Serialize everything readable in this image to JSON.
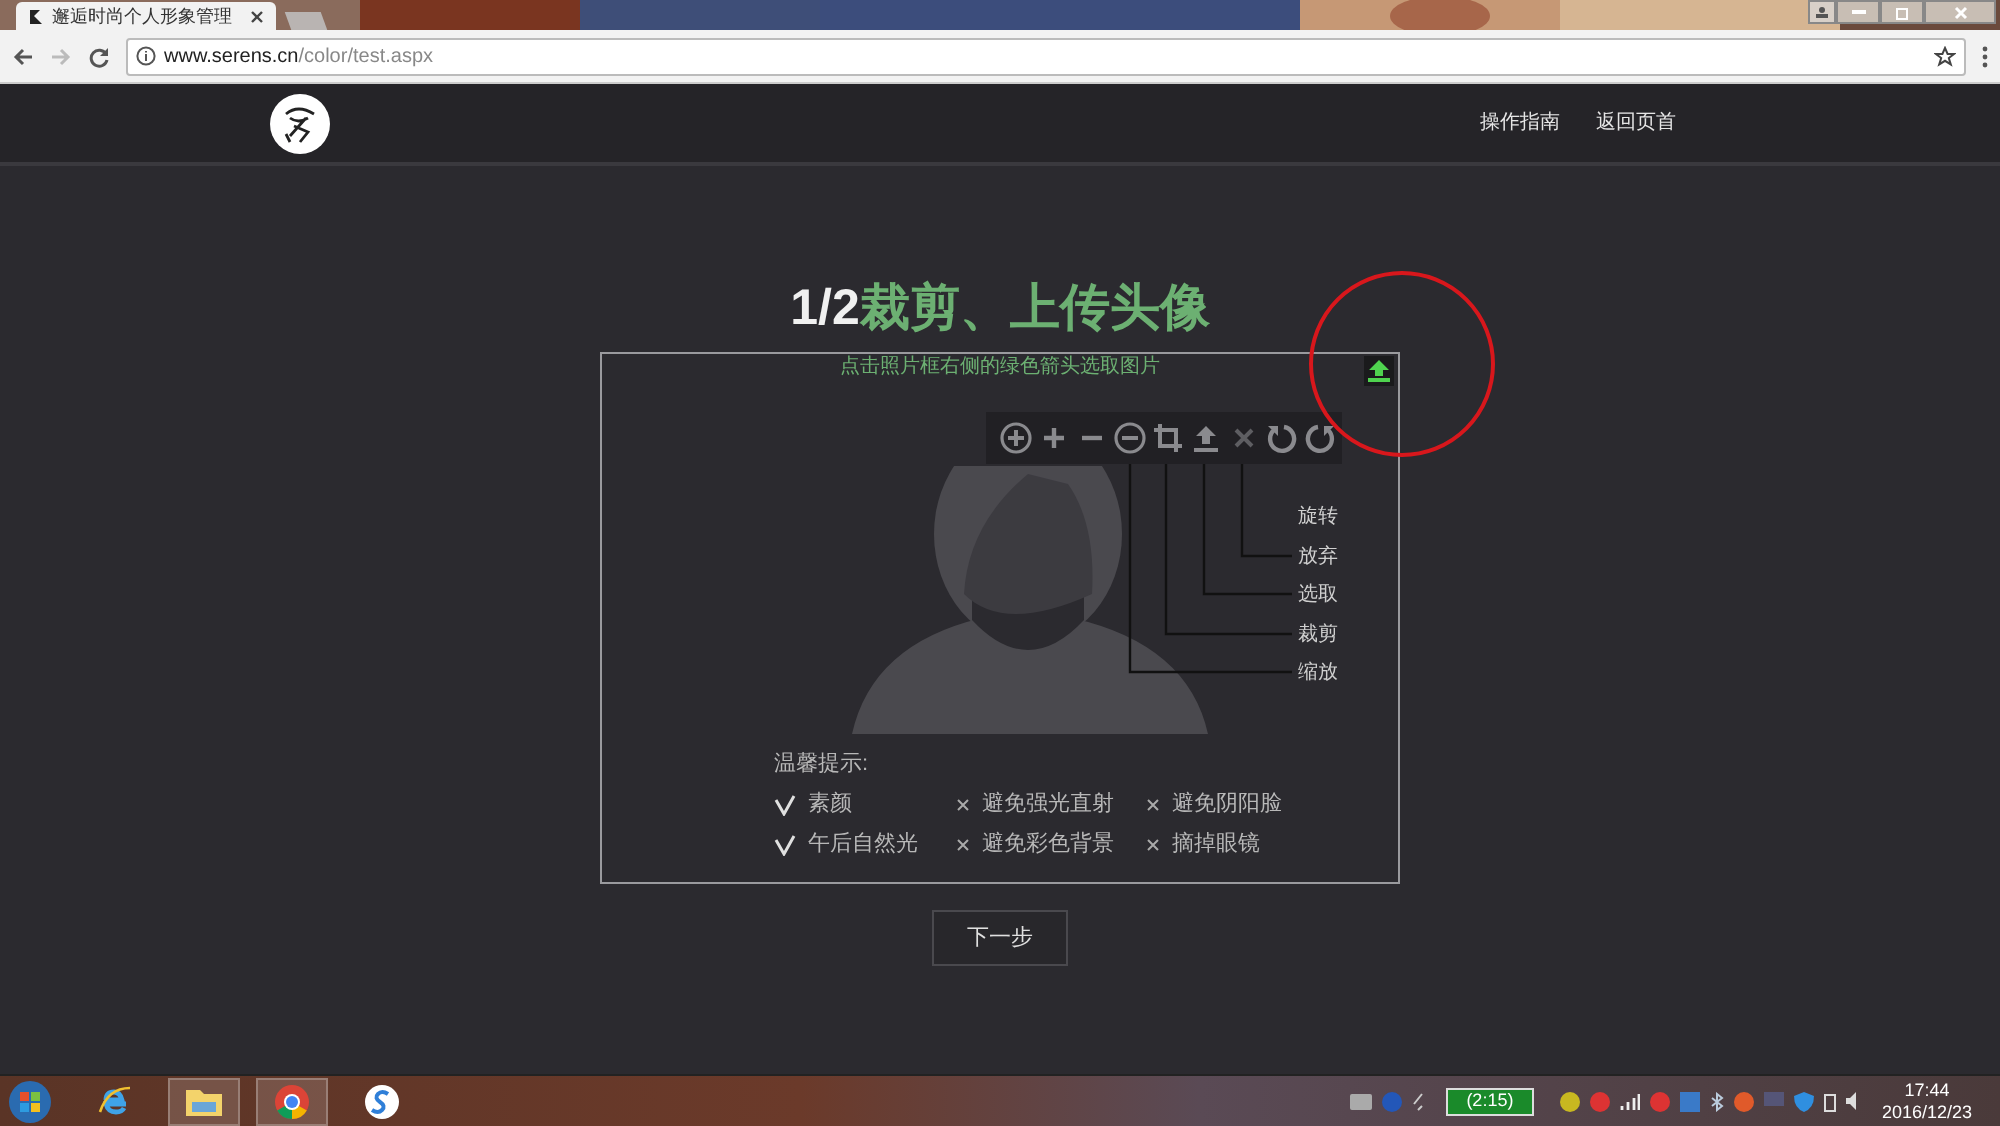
{
  "browser": {
    "tab_title": "邂逅时尚个人形象管理",
    "url_host": "www.serens.cn",
    "url_path": "/color/test.aspx"
  },
  "nav": [
    "操作指南",
    "返回页首"
  ],
  "heading": {
    "step": "1/2",
    "title": "裁剪、上传头像"
  },
  "hint": "点击照片框右侧的绿色箭头选取图片",
  "tool_labels": [
    "旋转",
    "放弃",
    "选取",
    "裁剪",
    "缩放"
  ],
  "tips": {
    "title": "温馨提示:",
    "items": [
      {
        "kind": "do",
        "text": "素颜"
      },
      {
        "kind": "avoid",
        "text": "避免强光直射"
      },
      {
        "kind": "avoid",
        "text": "避免阴阳脸"
      },
      {
        "kind": "do",
        "text": "午后自然光"
      },
      {
        "kind": "avoid",
        "text": "避免彩色背景"
      },
      {
        "kind": "avoid",
        "text": "摘掉眼镜"
      }
    ]
  },
  "next_button": "下一步",
  "taskbar": {
    "battery": "(2:15)",
    "time": "17:44",
    "date": "2016/12/23"
  }
}
